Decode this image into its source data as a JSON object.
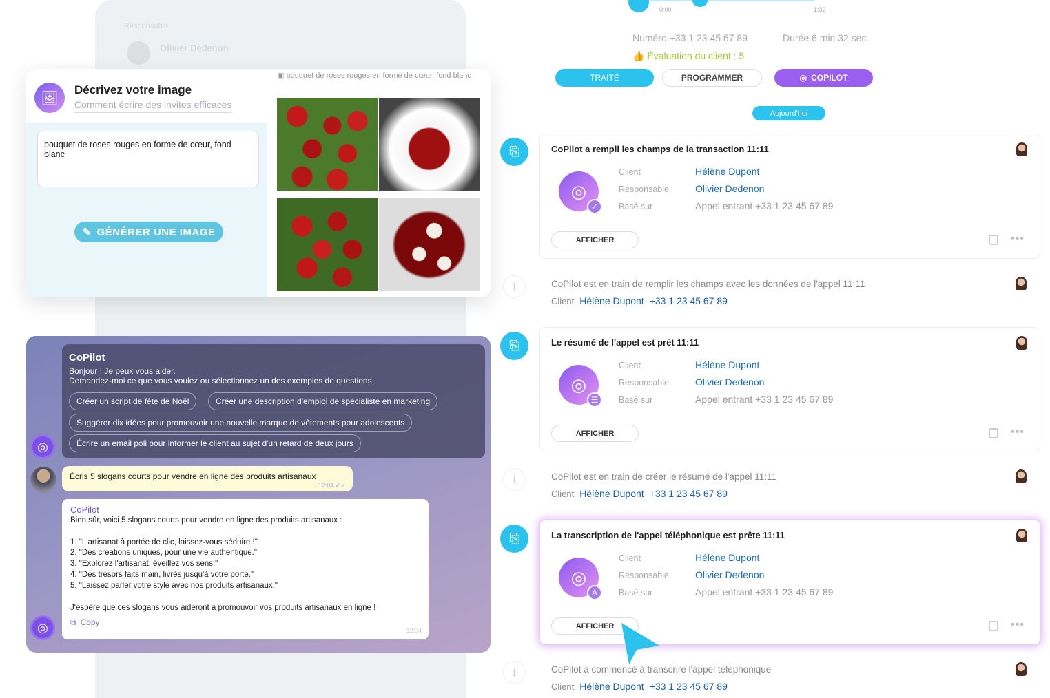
{
  "background": {
    "section_label": "Responsable",
    "name": "Olivier Dedenon"
  },
  "image_generator": {
    "title": "Décrivez votre image",
    "help_link": "Comment écrire des invites efficaces",
    "prompt": "bouquet de roses rouges en forme de cœur, fond blanc",
    "generate_button": "GÉNÉRER UNE IMAGE",
    "caption": "bouquet de roses rouges en forme de cœur, fond blanc"
  },
  "chat": {
    "title": "CoPilot",
    "greeting": "Bonjour ! Je peux vous aider.",
    "instructions": "Demandez-moi ce que vous voulez ou sélectionnez un des exemples de questions.",
    "suggestions": [
      "Créer un script de fête de Noël",
      "Créer une description d'emploi de spécialiste en marketing",
      "Suggérer dix idées pour promouvoir une nouvelle marque de vêtements pour adolescents",
      "Écrire un email poli pour informer le client au sujet d'un retard de deux jours"
    ],
    "user_message": "Écris 5 slogans courts pour vendre en ligne des produits artisanaux",
    "user_time": "12:04",
    "reply_author": "CoPilot",
    "reply_intro": "Bien sûr, voici 5 slogans courts pour vendre en ligne des produits artisanaux :",
    "reply_items": [
      "1. \"L'artisanat à portée de clic, laissez-vous séduire !\"",
      "2. \"Des créations uniques, pour une vie authentique.\"",
      "3. \"Explorez l'artisanat, éveillez vos sens.\"",
      "4. \"Des trésors faits main, livrés jusqu'à votre porte.\"",
      "5. \"Laissez parler votre style avec nos produits artisanaux.\""
    ],
    "reply_outro": "J'espère que ces slogans vous aideront à promouvoir vos produits artisanaux en ligne !",
    "copy_label": "Copy",
    "reply_time": "12:04"
  },
  "call": {
    "time_start": "0:00",
    "time_end": "1:32",
    "number": "Numéro +33 1 23 45 67 89",
    "duration": "Durée 6 min 32 sec",
    "rating": "Évaluation du client : 5",
    "buttons": {
      "treated": "TRAITÉ",
      "schedule": "PROGRAMMER",
      "copilot": "COPILOT"
    },
    "today": "Aujourd'hui"
  },
  "timeline": {
    "labels": {
      "client": "Client",
      "responsible": "Responsable",
      "based_on": "Basé sur",
      "show": "AFFICHER"
    },
    "cards": [
      {
        "title": "CoPilot a rempli les champs de la transaction 11:11",
        "client": "Hélène Dupont",
        "responsible": "Olivier Dedenon",
        "based_on": "Appel entrant +33 1 23 45 67 89",
        "badge_icon": "check-icon"
      },
      {
        "title": "Le résumé de l'appel est prêt 11:11",
        "client": "Hélène Dupont",
        "responsible": "Olivier Dedenon",
        "based_on": "Appel entrant +33 1 23 45 67 89",
        "badge_icon": "list-icon"
      },
      {
        "title": "La transcription de l'appel téléphonique est prête 11:11",
        "client": "Hélène Dupont",
        "responsible": "Olivier Dedenon",
        "based_on": "Appel entrant +33 1 23 45 67 89",
        "badge_icon": "letter-a-icon"
      }
    ],
    "infos": [
      {
        "text": "CoPilot est en train de remplir les champs avec les données de l'appel 11:11",
        "client": "Hélène Dupont",
        "phone": "+33 1 23 45 67 89"
      },
      {
        "text": "CoPilot est en train de créer le résumé de l'appel 11:11",
        "client": "Hélène Dupont",
        "phone": "+33 1 23 45 67 89"
      },
      {
        "text": "CoPilot a commencé à transcrire l'appel téléphonique",
        "client": "Hélène Dupont",
        "phone": "+33 1 23 45 67 89"
      }
    ]
  },
  "colors": {
    "accent": "#2cc2ee",
    "copilot": "#9b5ff0",
    "link": "#1a6fc7",
    "rating": "#a6c835"
  }
}
